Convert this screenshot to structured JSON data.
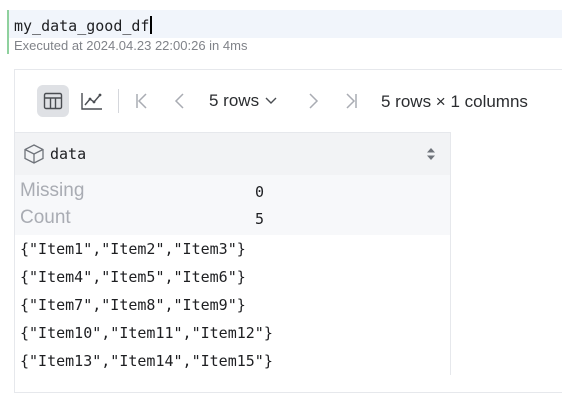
{
  "cell": {
    "code": "my_data_good_df",
    "exec_info": "Executed at 2024.04.23 22:00:26 in 4ms"
  },
  "toolbar": {
    "table_view_icon": "table-icon",
    "chart_view_icon": "chart-icon",
    "first_page_icon": "first-page-icon",
    "prev_page_icon": "chevron-left-icon",
    "rows_select_value": "5 rows",
    "next_page_icon": "chevron-right-icon",
    "last_page_icon": "last-page-icon",
    "dimensions": "5 rows × 1 columns"
  },
  "table": {
    "column": {
      "icon": "cube-icon",
      "name": "data",
      "sort_icon": "sort-icon"
    },
    "stats": [
      {
        "label": "Missing",
        "value": "0"
      },
      {
        "label": "Count",
        "value": "5"
      }
    ],
    "rows": [
      "{\"Item1\",\"Item2\",\"Item3\"}",
      "{\"Item4\",\"Item5\",\"Item6\"}",
      "{\"Item7\",\"Item8\",\"Item9\"}",
      "{\"Item10\",\"Item11\",\"Item12\"}",
      "{\"Item13\",\"Item14\",\"Item15\"}"
    ]
  },
  "colors": {
    "cell_bar": "#8fd19e",
    "code_bg": "#f1f5fb",
    "active_button": "#dfe1e5"
  }
}
